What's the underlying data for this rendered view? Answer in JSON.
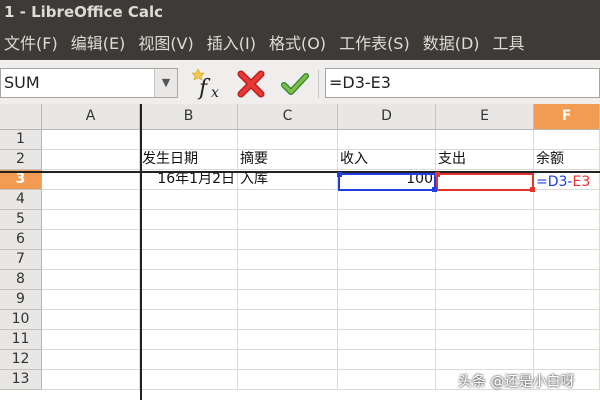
{
  "window": {
    "title": "1 - LibreOffice Calc"
  },
  "menu": [
    {
      "label": "文件(F)"
    },
    {
      "label": "编辑(E)"
    },
    {
      "label": "视图(V)"
    },
    {
      "label": "插入(I)"
    },
    {
      "label": "格式(O)"
    },
    {
      "label": "工作表(S)"
    },
    {
      "label": "数据(D)"
    },
    {
      "label": "工具"
    }
  ],
  "formula_bar": {
    "name_box": "SUM",
    "formula": "=D3-E3",
    "icons": {
      "function_wizard": "fx-icon",
      "cancel": "cancel-x-icon",
      "accept": "checkmark-icon"
    }
  },
  "columns": [
    "A",
    "B",
    "C",
    "D",
    "E",
    "F"
  ],
  "active_column": "F",
  "rows": [
    "1",
    "2",
    "3",
    "4",
    "5",
    "6",
    "7",
    "8",
    "9",
    "10",
    "11",
    "12",
    "13"
  ],
  "active_row": "3",
  "cells": {
    "B2": "发生日期",
    "C2": "摘要",
    "D2": "收入",
    "E2": "支出",
    "F2": "余额",
    "B3": "16年1月2日",
    "C3": "入库",
    "D3": "100",
    "E3": "",
    "F3": {
      "eq": "=",
      "ref1": "D3",
      "op": "-",
      "ref2": "E3"
    }
  },
  "colors": {
    "active_header": "#f29b52",
    "ref_blue": "#1f3ee6",
    "ref_red": "#e8302c"
  },
  "watermark": "头条 @还是小白呀"
}
